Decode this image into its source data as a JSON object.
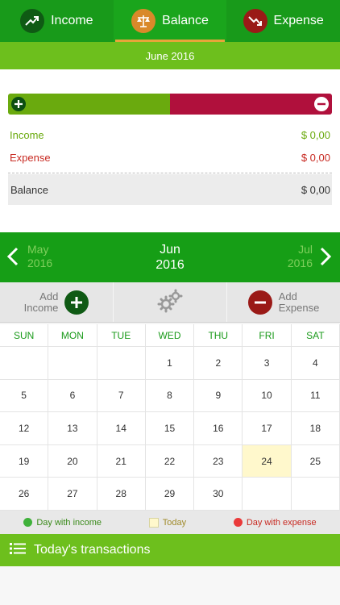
{
  "tabs": [
    {
      "label": "Income",
      "icon": "trend-up-icon"
    },
    {
      "label": "Balance",
      "icon": "scales-icon"
    },
    {
      "label": "Expense",
      "icon": "trend-down-icon"
    }
  ],
  "active_tab": "Balance",
  "period_label": "June 2016",
  "summary": {
    "income_share": 0.5,
    "income_label": "Income",
    "income_value": "$ 0,00",
    "expense_label": "Expense",
    "expense_value": "$ 0,00",
    "balance_label": "Balance",
    "balance_value": "$ 0,00"
  },
  "month_nav": {
    "prev_month": "May",
    "prev_year": "2016",
    "current_month": "Jun",
    "current_year": "2016",
    "next_month": "Jul",
    "next_year": "2016"
  },
  "actions": {
    "add_income_line1": "Add",
    "add_income_line2": "Income",
    "settings_icon": "gears-icon",
    "add_expense_line1": "Add",
    "add_expense_line2": "Expense"
  },
  "calendar": {
    "weekdays": [
      "SUN",
      "MON",
      "TUE",
      "WED",
      "THU",
      "FRI",
      "SAT"
    ],
    "weeks": [
      [
        "",
        "",
        "",
        "1",
        "2",
        "3",
        "4"
      ],
      [
        "5",
        "6",
        "7",
        "8",
        "9",
        "10",
        "11"
      ],
      [
        "12",
        "13",
        "14",
        "15",
        "16",
        "17",
        "18"
      ],
      [
        "19",
        "20",
        "21",
        "22",
        "23",
        "24",
        "25"
      ],
      [
        "26",
        "27",
        "28",
        "29",
        "30",
        "",
        ""
      ]
    ],
    "today": "24"
  },
  "legend": {
    "income": "Day with income",
    "today": "Today",
    "expense": "Day with expense"
  },
  "transactions_title": "Today's transactions",
  "colors": {
    "primary_green": "#189a1a",
    "light_green": "#6dbf1d",
    "income": "#6aaa0e",
    "expense": "#b0103c",
    "today_bg": "#fff8cc"
  }
}
